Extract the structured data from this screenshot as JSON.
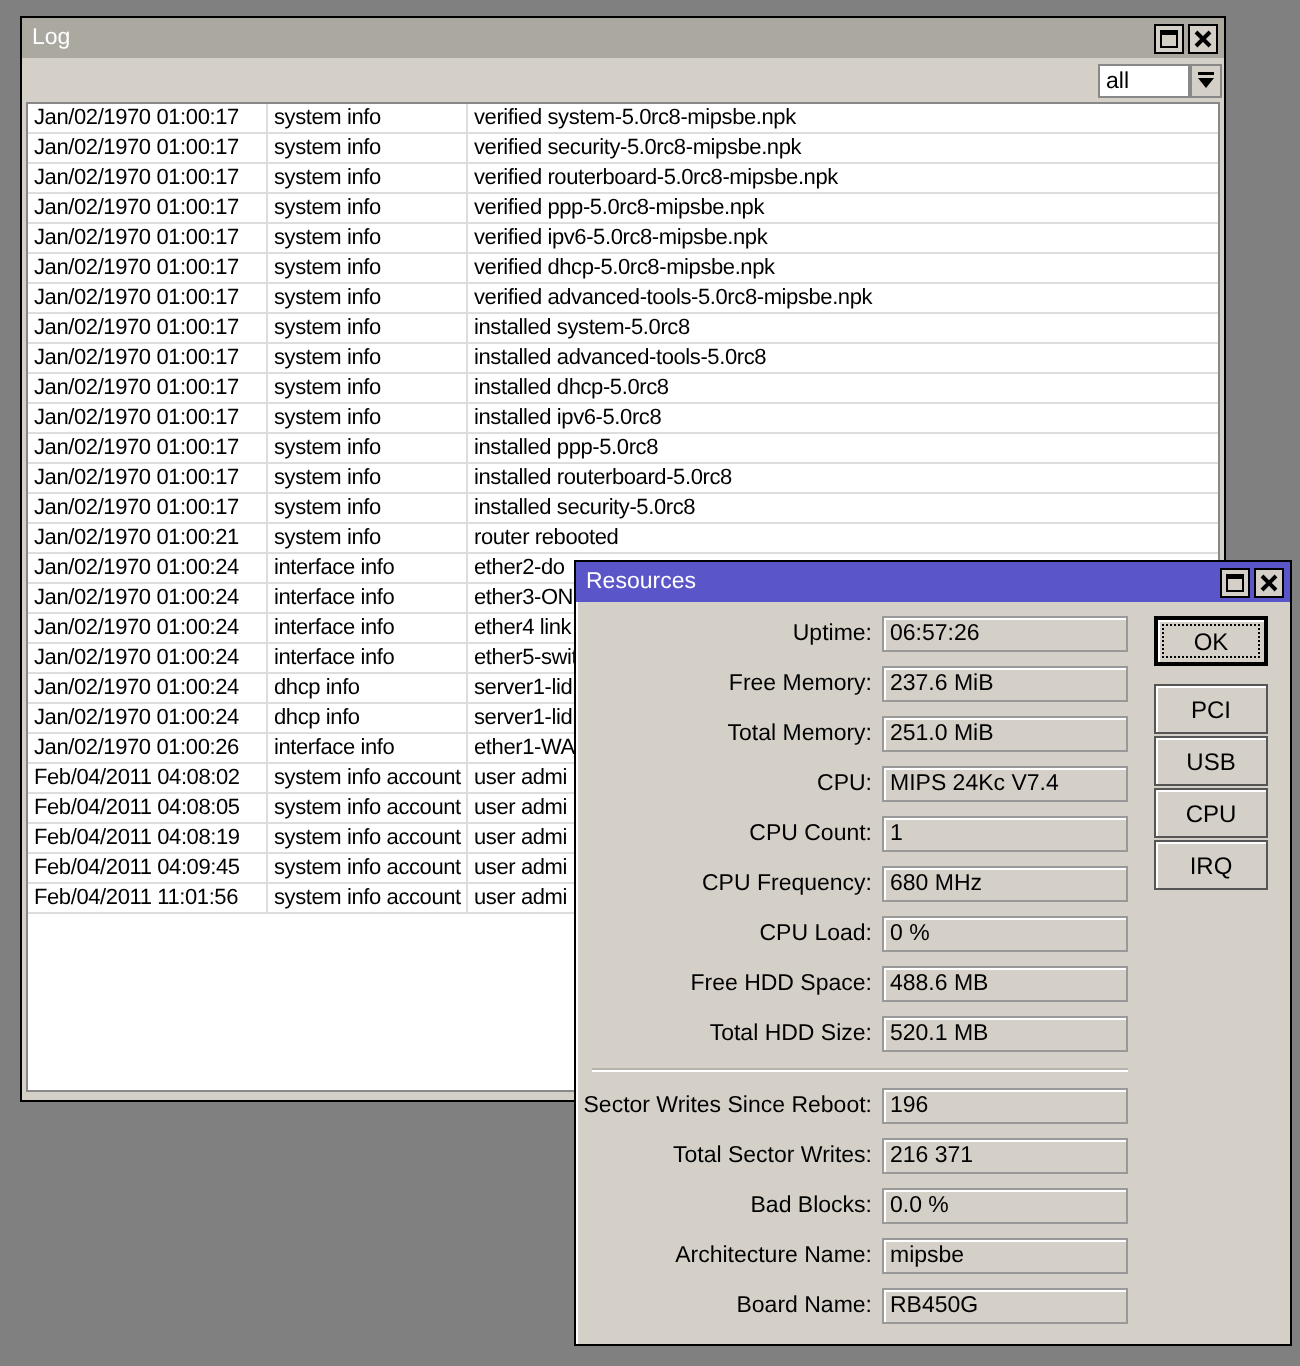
{
  "log": {
    "title": "Log",
    "filter": "all",
    "rows": [
      [
        "Jan/02/1970 01:00:17",
        "system info",
        "verified system-5.0rc8-mipsbe.npk"
      ],
      [
        "Jan/02/1970 01:00:17",
        "system info",
        "verified security-5.0rc8-mipsbe.npk"
      ],
      [
        "Jan/02/1970 01:00:17",
        "system info",
        "verified routerboard-5.0rc8-mipsbe.npk"
      ],
      [
        "Jan/02/1970 01:00:17",
        "system info",
        "verified ppp-5.0rc8-mipsbe.npk"
      ],
      [
        "Jan/02/1970 01:00:17",
        "system info",
        "verified ipv6-5.0rc8-mipsbe.npk"
      ],
      [
        "Jan/02/1970 01:00:17",
        "system info",
        "verified dhcp-5.0rc8-mipsbe.npk"
      ],
      [
        "Jan/02/1970 01:00:17",
        "system info",
        "verified advanced-tools-5.0rc8-mipsbe.npk"
      ],
      [
        "Jan/02/1970 01:00:17",
        "system info",
        "installed system-5.0rc8"
      ],
      [
        "Jan/02/1970 01:00:17",
        "system info",
        "installed advanced-tools-5.0rc8"
      ],
      [
        "Jan/02/1970 01:00:17",
        "system info",
        "installed dhcp-5.0rc8"
      ],
      [
        "Jan/02/1970 01:00:17",
        "system info",
        "installed ipv6-5.0rc8"
      ],
      [
        "Jan/02/1970 01:00:17",
        "system info",
        "installed ppp-5.0rc8"
      ],
      [
        "Jan/02/1970 01:00:17",
        "system info",
        "installed routerboard-5.0rc8"
      ],
      [
        "Jan/02/1970 01:00:17",
        "system info",
        "installed security-5.0rc8"
      ],
      [
        "Jan/02/1970 01:00:21",
        "system info",
        "router rebooted"
      ],
      [
        "Jan/02/1970 01:00:24",
        "interface info",
        "ether2-do"
      ],
      [
        "Jan/02/1970 01:00:24",
        "interface info",
        "ether3-ON"
      ],
      [
        "Jan/02/1970 01:00:24",
        "interface info",
        "ether4 link"
      ],
      [
        "Jan/02/1970 01:00:24",
        "interface info",
        "ether5-swit"
      ],
      [
        "Jan/02/1970 01:00:24",
        "dhcp info",
        "server1-lid"
      ],
      [
        "Jan/02/1970 01:00:24",
        "dhcp info",
        "server1-lid"
      ],
      [
        "Jan/02/1970 01:00:26",
        "interface info",
        "ether1-WA"
      ],
      [
        "Feb/04/2011 04:08:02",
        "system info account",
        "user admi"
      ],
      [
        "Feb/04/2011 04:08:05",
        "system info account",
        "user admi"
      ],
      [
        "Feb/04/2011 04:08:19",
        "system info account",
        "user admi"
      ],
      [
        "Feb/04/2011 04:09:45",
        "system info account",
        "user admi"
      ],
      [
        "Feb/04/2011 11:01:56",
        "system info account",
        "user admi"
      ]
    ]
  },
  "resources": {
    "title": "Resources",
    "groups": [
      [
        {
          "label": "Uptime:",
          "value": "06:57:26"
        },
        {
          "label": "Free Memory:",
          "value": "237.6 MiB"
        },
        {
          "label": "Total Memory:",
          "value": "251.0 MiB"
        },
        {
          "label": "CPU:",
          "value": "MIPS 24Kc V7.4"
        },
        {
          "label": "CPU Count:",
          "value": "1"
        },
        {
          "label": "CPU Frequency:",
          "value": "680 MHz"
        },
        {
          "label": "CPU Load:",
          "value": "0 %"
        },
        {
          "label": "Free HDD Space:",
          "value": "488.6 MB"
        },
        {
          "label": "Total HDD Size:",
          "value": "520.1 MB"
        }
      ],
      [
        {
          "label": "Sector Writes Since Reboot:",
          "value": "196"
        },
        {
          "label": "Total Sector Writes:",
          "value": "216 371"
        },
        {
          "label": "Bad Blocks:",
          "value": "0.0 %"
        },
        {
          "label": "Architecture Name:",
          "value": "mipsbe"
        },
        {
          "label": "Board Name:",
          "value": "RB450G"
        }
      ]
    ],
    "buttons": [
      {
        "label": "OK",
        "default": true
      },
      {
        "label": "PCI",
        "default": false
      },
      {
        "label": "USB",
        "default": false
      },
      {
        "label": "CPU",
        "default": false
      },
      {
        "label": "IRQ",
        "default": false
      }
    ]
  }
}
